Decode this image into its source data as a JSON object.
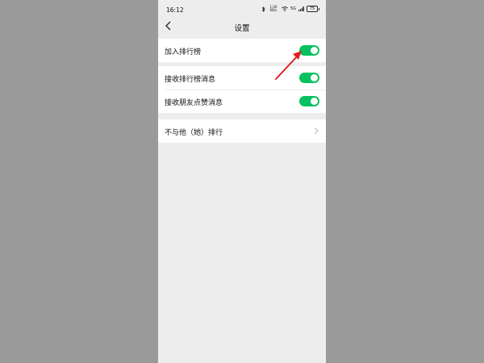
{
  "status_bar": {
    "time": "16:12",
    "network_speed": "1.00 KB/s",
    "signal": "5G",
    "battery": "75"
  },
  "nav": {
    "title": "设置",
    "back_icon": "chevron-left-icon"
  },
  "settings": {
    "ranking_join": {
      "label": "加入排行榜",
      "on": true
    },
    "notifications": [
      {
        "label": "接收排行榜消息",
        "on": true
      },
      {
        "label": "接收朋友点赞消息",
        "on": true
      }
    ],
    "exclude": {
      "label": "不与他（她）排行",
      "icon": "chevron-right-icon"
    }
  },
  "colors": {
    "toggle_on": "#07c160",
    "page_background": "#ededed",
    "annotation_arrow": "#e02020"
  }
}
